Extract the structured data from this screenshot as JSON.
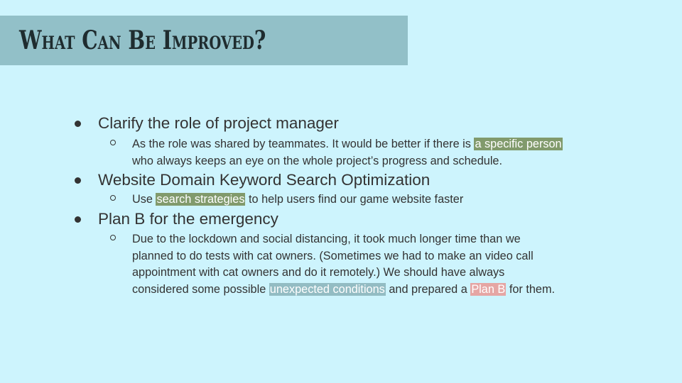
{
  "slide": {
    "title": "What Can Be Improved?",
    "colors": {
      "background": "#cdf4fd",
      "title_bar": "#92c0c8",
      "highlight_green": "#819a6c",
      "highlight_teal": "#93bcc3",
      "highlight_pink": "#e5a6a4"
    }
  },
  "items": [
    {
      "heading": "Clarify the role of project manager",
      "sub": {
        "line1_pre": "As the role was shared by teammates. It would be better if there is ",
        "line1_hl": "a specific person",
        "line2": "who always keeps an eye on the whole project’s progress and schedule."
      }
    },
    {
      "heading": "Website Domain Keyword Search Optimization",
      "sub": {
        "pre": "Use ",
        "hl": "search strategies",
        "post": " to help users find our game website faster"
      }
    },
    {
      "heading": "Plan B for the emergency",
      "sub": {
        "line1": "Due to the lockdown and social distancing, it took much longer time than we",
        "line2": "planned to do tests with cat owners. (Sometimes we had to make an video call",
        "line3": "appointment with cat owners and do it remotely.) We should have always",
        "line4_pre": "considered some possible ",
        "line4_hl1": "unexpected conditions",
        "line4_mid": " and prepared a ",
        "line4_hl2": "Plan B",
        "line4_post": " for them."
      }
    }
  ]
}
